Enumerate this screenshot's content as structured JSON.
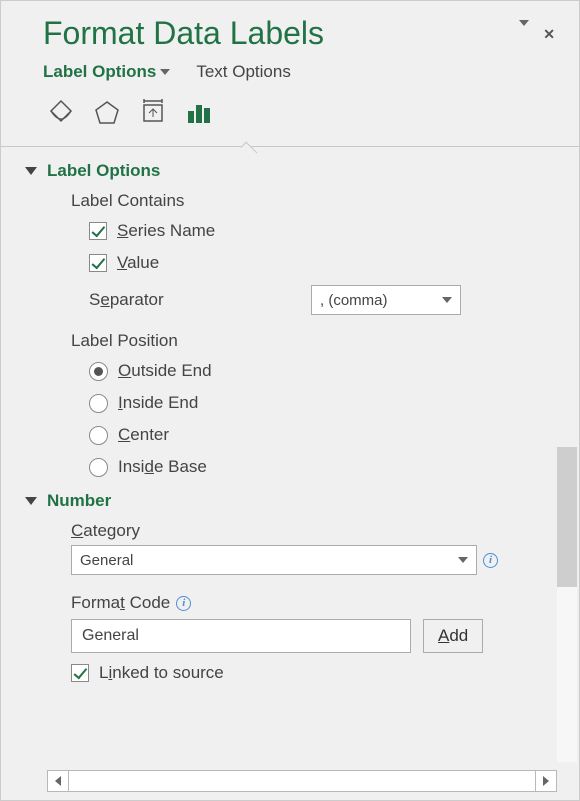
{
  "title": "Format Data Labels",
  "tabs": {
    "labelOptions": "Label Options",
    "textOptions": "Text Options"
  },
  "sections": {
    "labelOptions": {
      "header": "Label Options",
      "labelContains": "Label Contains",
      "seriesName": "Series Name",
      "value": "Value",
      "separatorLabel": "Separator",
      "separatorValue": ", (comma)",
      "labelPosition": "Label Position",
      "outsideEnd": "Outside End",
      "insideEnd": "Inside End",
      "center": "Center",
      "insideBase": "Inside Base"
    },
    "number": {
      "header": "Number",
      "categoryLabel": "Category",
      "categoryValue": "General",
      "formatCodeLabel": "Format Code",
      "formatCodeValue": "General",
      "addButton": "Add",
      "linked": "Linked to source"
    }
  }
}
